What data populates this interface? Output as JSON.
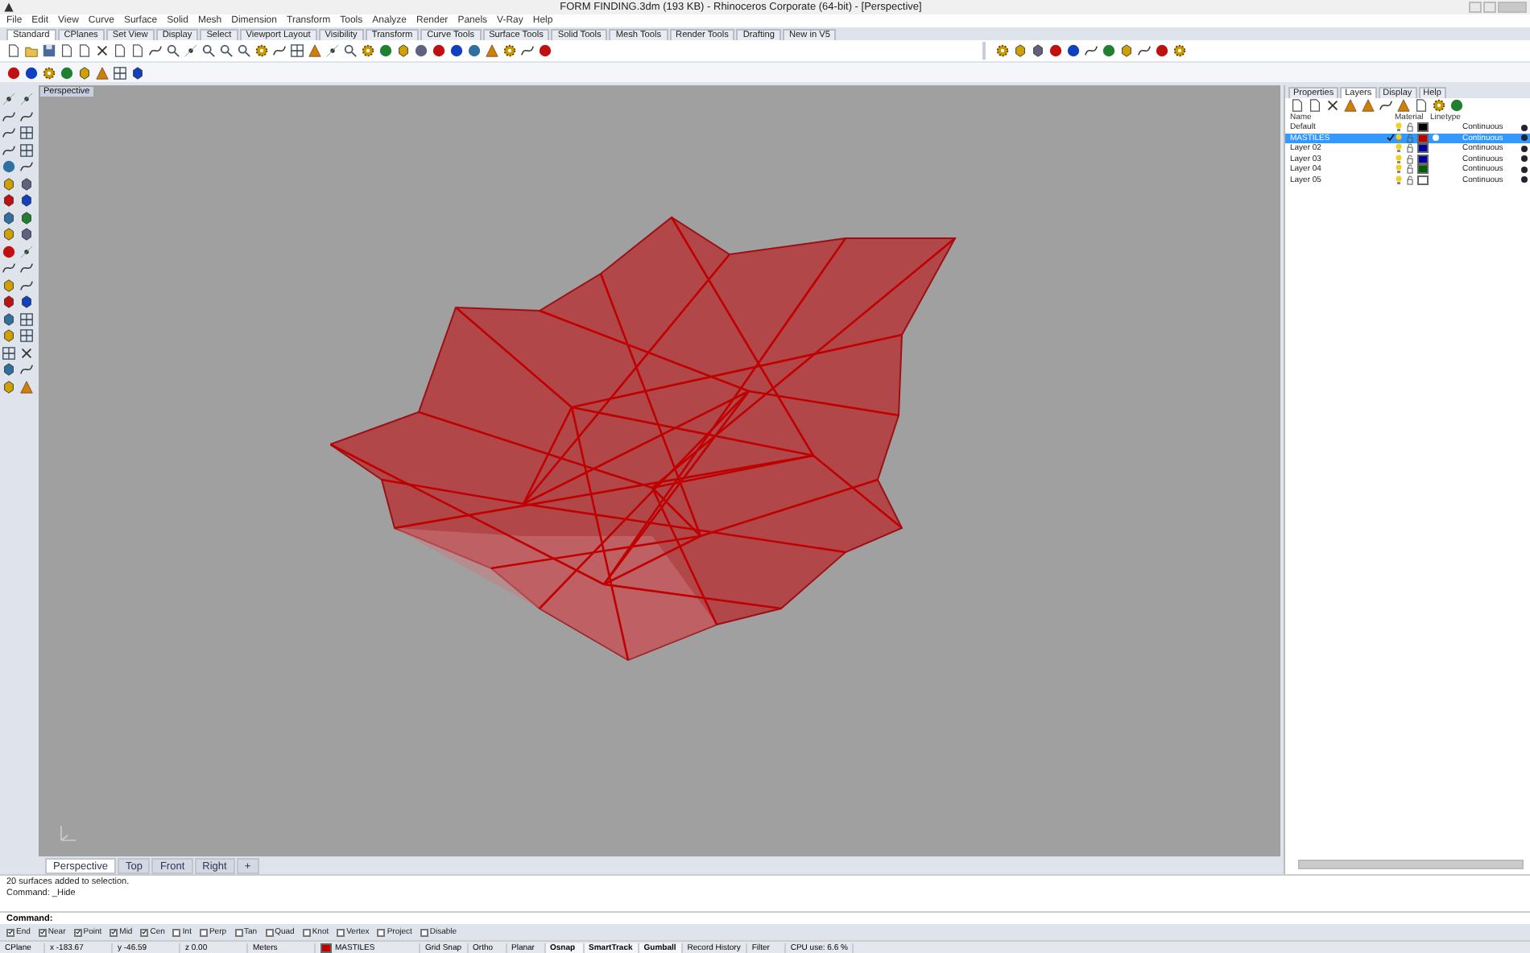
{
  "window": {
    "title": "FORM FINDING.3dm (193 KB) - Rhinoceros Corporate (64-bit) - [Perspective]"
  },
  "menu": [
    "File",
    "Edit",
    "View",
    "Curve",
    "Surface",
    "Solid",
    "Mesh",
    "Dimension",
    "Transform",
    "Tools",
    "Analyze",
    "Render",
    "Panels",
    "V-Ray",
    "Help"
  ],
  "toolbar_tabs": [
    {
      "label": "Standard",
      "selected": true
    },
    {
      "label": "CPlanes",
      "selected": false
    },
    {
      "label": "Set View",
      "selected": false
    },
    {
      "label": "Display",
      "selected": false
    },
    {
      "label": "Select",
      "selected": false
    },
    {
      "label": "Viewport Layout",
      "selected": false
    },
    {
      "label": "Visibility",
      "selected": false
    },
    {
      "label": "Transform",
      "selected": false
    },
    {
      "label": "Curve Tools",
      "selected": false
    },
    {
      "label": "Surface Tools",
      "selected": false
    },
    {
      "label": "Solid Tools",
      "selected": false
    },
    {
      "label": "Mesh Tools",
      "selected": false
    },
    {
      "label": "Render Tools",
      "selected": false
    },
    {
      "label": "Drafting",
      "selected": false
    },
    {
      "label": "New in V5",
      "selected": false
    }
  ],
  "viewport": {
    "label": "Perspective"
  },
  "panel": {
    "tabs": [
      {
        "label": "Properties",
        "selected": false
      },
      {
        "label": "Layers",
        "selected": true
      },
      {
        "label": "Display",
        "selected": false
      },
      {
        "label": "Help",
        "selected": false
      }
    ],
    "columns": [
      "Name",
      "Material",
      "Linetype"
    ],
    "layers": [
      {
        "name": "Default",
        "selected": false,
        "current": false,
        "color": "#000000",
        "linetype": "Continuous"
      },
      {
        "name": "MASTILES",
        "selected": true,
        "current": true,
        "color": "#c00000",
        "linetype": "Continuous"
      },
      {
        "name": "Layer 02",
        "selected": false,
        "current": false,
        "color": "#0000a0",
        "linetype": "Continuous"
      },
      {
        "name": "Layer 03",
        "selected": false,
        "current": false,
        "color": "#0000a0",
        "linetype": "Continuous"
      },
      {
        "name": "Layer 04",
        "selected": false,
        "current": false,
        "color": "#006000",
        "linetype": "Continuous"
      },
      {
        "name": "Layer 05",
        "selected": false,
        "current": false,
        "color": "#ffffff",
        "linetype": "Continuous"
      }
    ]
  },
  "view_tabs": [
    {
      "label": "Perspective",
      "selected": true
    },
    {
      "label": "Top",
      "selected": false
    },
    {
      "label": "Front",
      "selected": false
    },
    {
      "label": "Right",
      "selected": false
    },
    {
      "label": "+",
      "selected": false
    }
  ],
  "command_history": [
    "20 surfaces added to selection.",
    "Command: _Hide"
  ],
  "command_prompt": "Command:",
  "osnaps": [
    {
      "label": "End",
      "checked": true
    },
    {
      "label": "Near",
      "checked": true
    },
    {
      "label": "Point",
      "checked": true
    },
    {
      "label": "Mid",
      "checked": true
    },
    {
      "label": "Cen",
      "checked": true
    },
    {
      "label": "Int",
      "checked": false
    },
    {
      "label": "Perp",
      "checked": false
    },
    {
      "label": "Tan",
      "checked": false
    },
    {
      "label": "Quad",
      "checked": false
    },
    {
      "label": "Knot",
      "checked": false
    },
    {
      "label": "Vertex",
      "checked": false
    },
    {
      "label": "Project",
      "checked": false
    },
    {
      "label": "Disable",
      "checked": false
    }
  ],
  "status_bar": [
    {
      "kind": "text",
      "label": "CPlane"
    },
    {
      "kind": "text",
      "label": "x -183.67"
    },
    {
      "kind": "text",
      "label": "y -46.59"
    },
    {
      "kind": "text",
      "label": "z 0.00"
    },
    {
      "kind": "text",
      "label": "Meters"
    },
    {
      "kind": "layer",
      "label": "MASTILES",
      "color": "#c00000"
    },
    {
      "kind": "toggle",
      "label": "Grid Snap",
      "on": false
    },
    {
      "kind": "toggle",
      "label": "Ortho",
      "on": false
    },
    {
      "kind": "toggle",
      "label": "Planar",
      "on": false
    },
    {
      "kind": "toggle",
      "label": "Osnap",
      "on": true
    },
    {
      "kind": "toggle",
      "label": "SmartTrack",
      "on": true
    },
    {
      "kind": "toggle",
      "label": "Gumball",
      "on": true
    },
    {
      "kind": "toggle",
      "label": "Record History",
      "on": false
    },
    {
      "kind": "toggle",
      "label": "Filter",
      "on": false
    },
    {
      "kind": "text",
      "label": "CPU use: 6.6 %"
    }
  ]
}
